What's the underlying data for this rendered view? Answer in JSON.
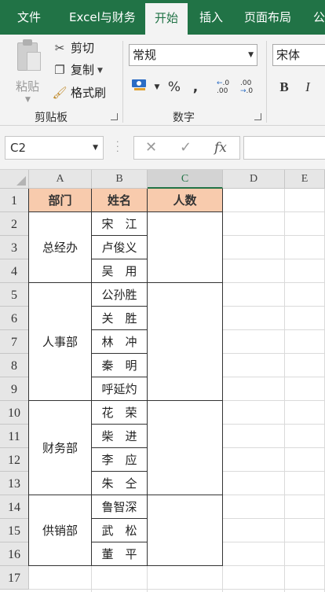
{
  "ribbon": {
    "tabs": [
      "文件",
      "Excel与财务",
      "开始",
      "插入",
      "页面布局",
      "公"
    ],
    "active_tab": "开始",
    "clipboard": {
      "paste_label": "粘贴",
      "cut_label": "剪切",
      "copy_label": "复制",
      "format_painter_label": "格式刷",
      "group_label": "剪贴板"
    },
    "number": {
      "format_value": "常规",
      "percent_symbol": "%",
      "comma_symbol": ",",
      "group_label": "数字"
    },
    "font": {
      "font_value": "宋体",
      "bold_label": "B",
      "italic_label": "I"
    }
  },
  "formula_bar": {
    "name_box": "C2",
    "fx_label": "fx",
    "formula_value": ""
  },
  "sheet": {
    "columns": [
      "A",
      "B",
      "C",
      "D",
      "E"
    ],
    "selected_column": "C",
    "rows": [
      "1",
      "2",
      "3",
      "4",
      "5",
      "6",
      "7",
      "8",
      "9",
      "10",
      "11",
      "12",
      "13",
      "14",
      "15",
      "16",
      "17"
    ],
    "headers": [
      "部门",
      "姓名",
      "人数"
    ],
    "departments": [
      {
        "name": "总经办",
        "people": [
          "宋　江",
          "卢俊义",
          "吴　用"
        ]
      },
      {
        "name": "人事部",
        "people": [
          "公孙胜",
          "关　胜",
          "林　冲",
          "秦　明",
          "呼延灼"
        ]
      },
      {
        "name": "财务部",
        "people": [
          "花　荣",
          "柴　进",
          "李　应",
          "朱　仝"
        ]
      },
      {
        "name": "供销部",
        "people": [
          "鲁智深",
          "武　松",
          "董　平"
        ]
      }
    ],
    "header_color": "#f8cbad",
    "accent_color": "#217346"
  }
}
